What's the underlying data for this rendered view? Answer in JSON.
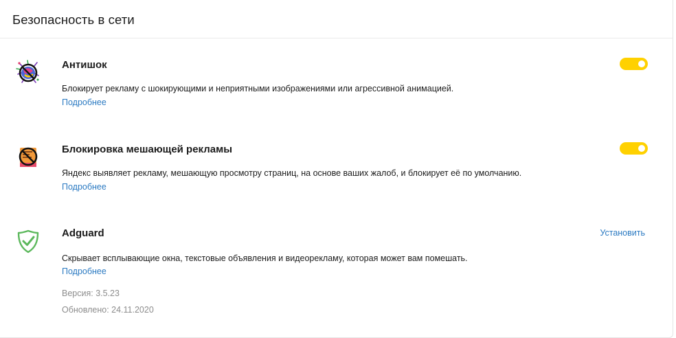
{
  "section": {
    "title": "Безопасность в сети"
  },
  "extensions": [
    {
      "name": "Антишок",
      "icon": "antishock-icon",
      "description": "Блокирует рекламу с шокирующими и неприятными изображениями или агрессивной анимацией.",
      "more_label": "Подробнее",
      "enabled": true
    },
    {
      "name": "Блокировка мешающей рекламы",
      "icon": "ad-block-icon",
      "description": "Яндекс выявляет рекламу, мешающую просмотру страниц, на основе ваших жалоб, и блокирует её по умолчанию.",
      "more_label": "Подробнее",
      "enabled": true
    },
    {
      "name": "Adguard",
      "icon": "adguard-shield-icon",
      "description": "Скрывает всплывающие окна, текстовые объявления и видеорекламу, которая может вам помешать.",
      "more_label": "Подробнее",
      "install_label": "Установить",
      "version": "Версия: 3.5.23",
      "updated": "Обновлено: 24.11.2020"
    }
  ],
  "colors": {
    "toggle_on": "#ffd100",
    "link": "#2b7ac2",
    "meta_text": "#8c8c8c",
    "adguard_green": "#5cb85c"
  }
}
